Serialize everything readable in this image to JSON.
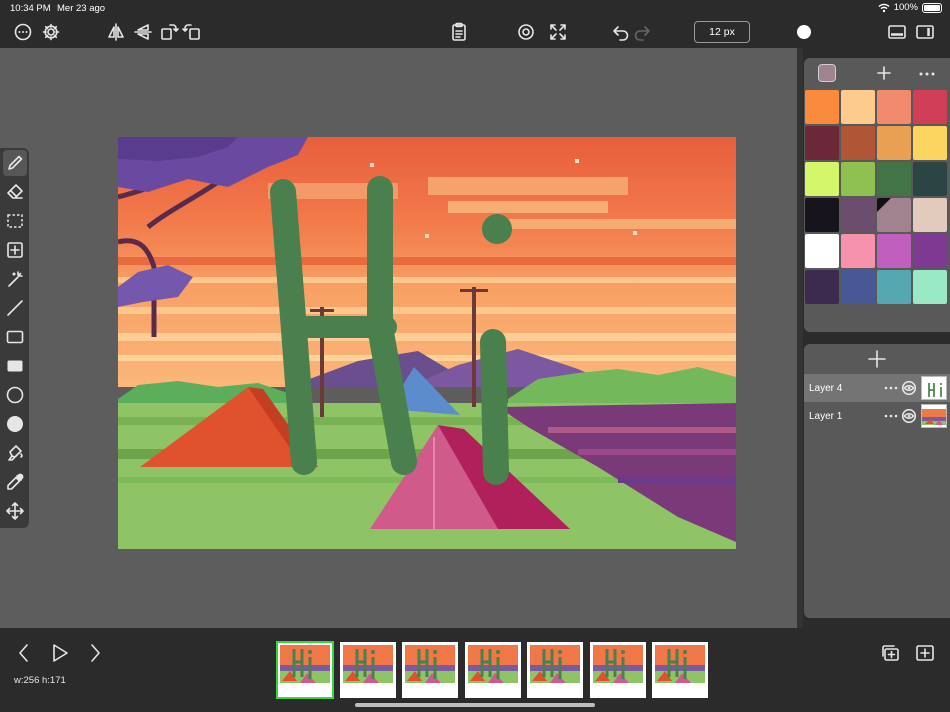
{
  "status": {
    "time": "10:34 PM",
    "date": "Mer 23 ago",
    "battery": "100%"
  },
  "toolbar": {
    "brush_size": "12 px",
    "icons": [
      "more-icon",
      "settings-icon",
      "flip-horizontal-icon",
      "flip-vertical-icon",
      "rotate-right-icon",
      "rotate-left-icon",
      "clipboard-icon",
      "center-target-icon",
      "fullscreen-icon",
      "undo-icon",
      "redo-icon",
      "brush-size-button",
      "brush-preview",
      "panel-toggle-bottom-icon",
      "panel-toggle-right-icon"
    ]
  },
  "tools": [
    "pencil",
    "eraser",
    "rect-select",
    "add-select",
    "magic-wand",
    "line",
    "rectangle-outline",
    "rectangle-filled",
    "ellipse-outline",
    "ellipse-filled",
    "fill-bucket",
    "eyedropper",
    "move"
  ],
  "palette": {
    "current_color": "#a0838f",
    "swatches": [
      "#fa8a3c",
      "#fecb8f",
      "#f28a6e",
      "#d13f57",
      "#6b2838",
      "#b05535",
      "#e9a052",
      "#fcd561",
      "#d4f66b",
      "#8ec150",
      "#437447",
      "#2b4544",
      "#18141d",
      "#6b4e6e",
      "#a0838f",
      "#e2cabd",
      "#ffffff",
      "#f792ac",
      "#c15fbf",
      "#7e3a93",
      "#3c2b4f",
      "#485897",
      "#55a7b1",
      "#99e8c6"
    ],
    "selected_index": 14
  },
  "layers": [
    {
      "name": "Layer 4",
      "active": true
    },
    {
      "name": "Layer 1",
      "active": false
    }
  ],
  "canvas_info": "w:256 h:171",
  "frames": [
    "1",
    "2",
    "3",
    "4",
    "5",
    "6",
    "7"
  ],
  "active_frame": 0
}
